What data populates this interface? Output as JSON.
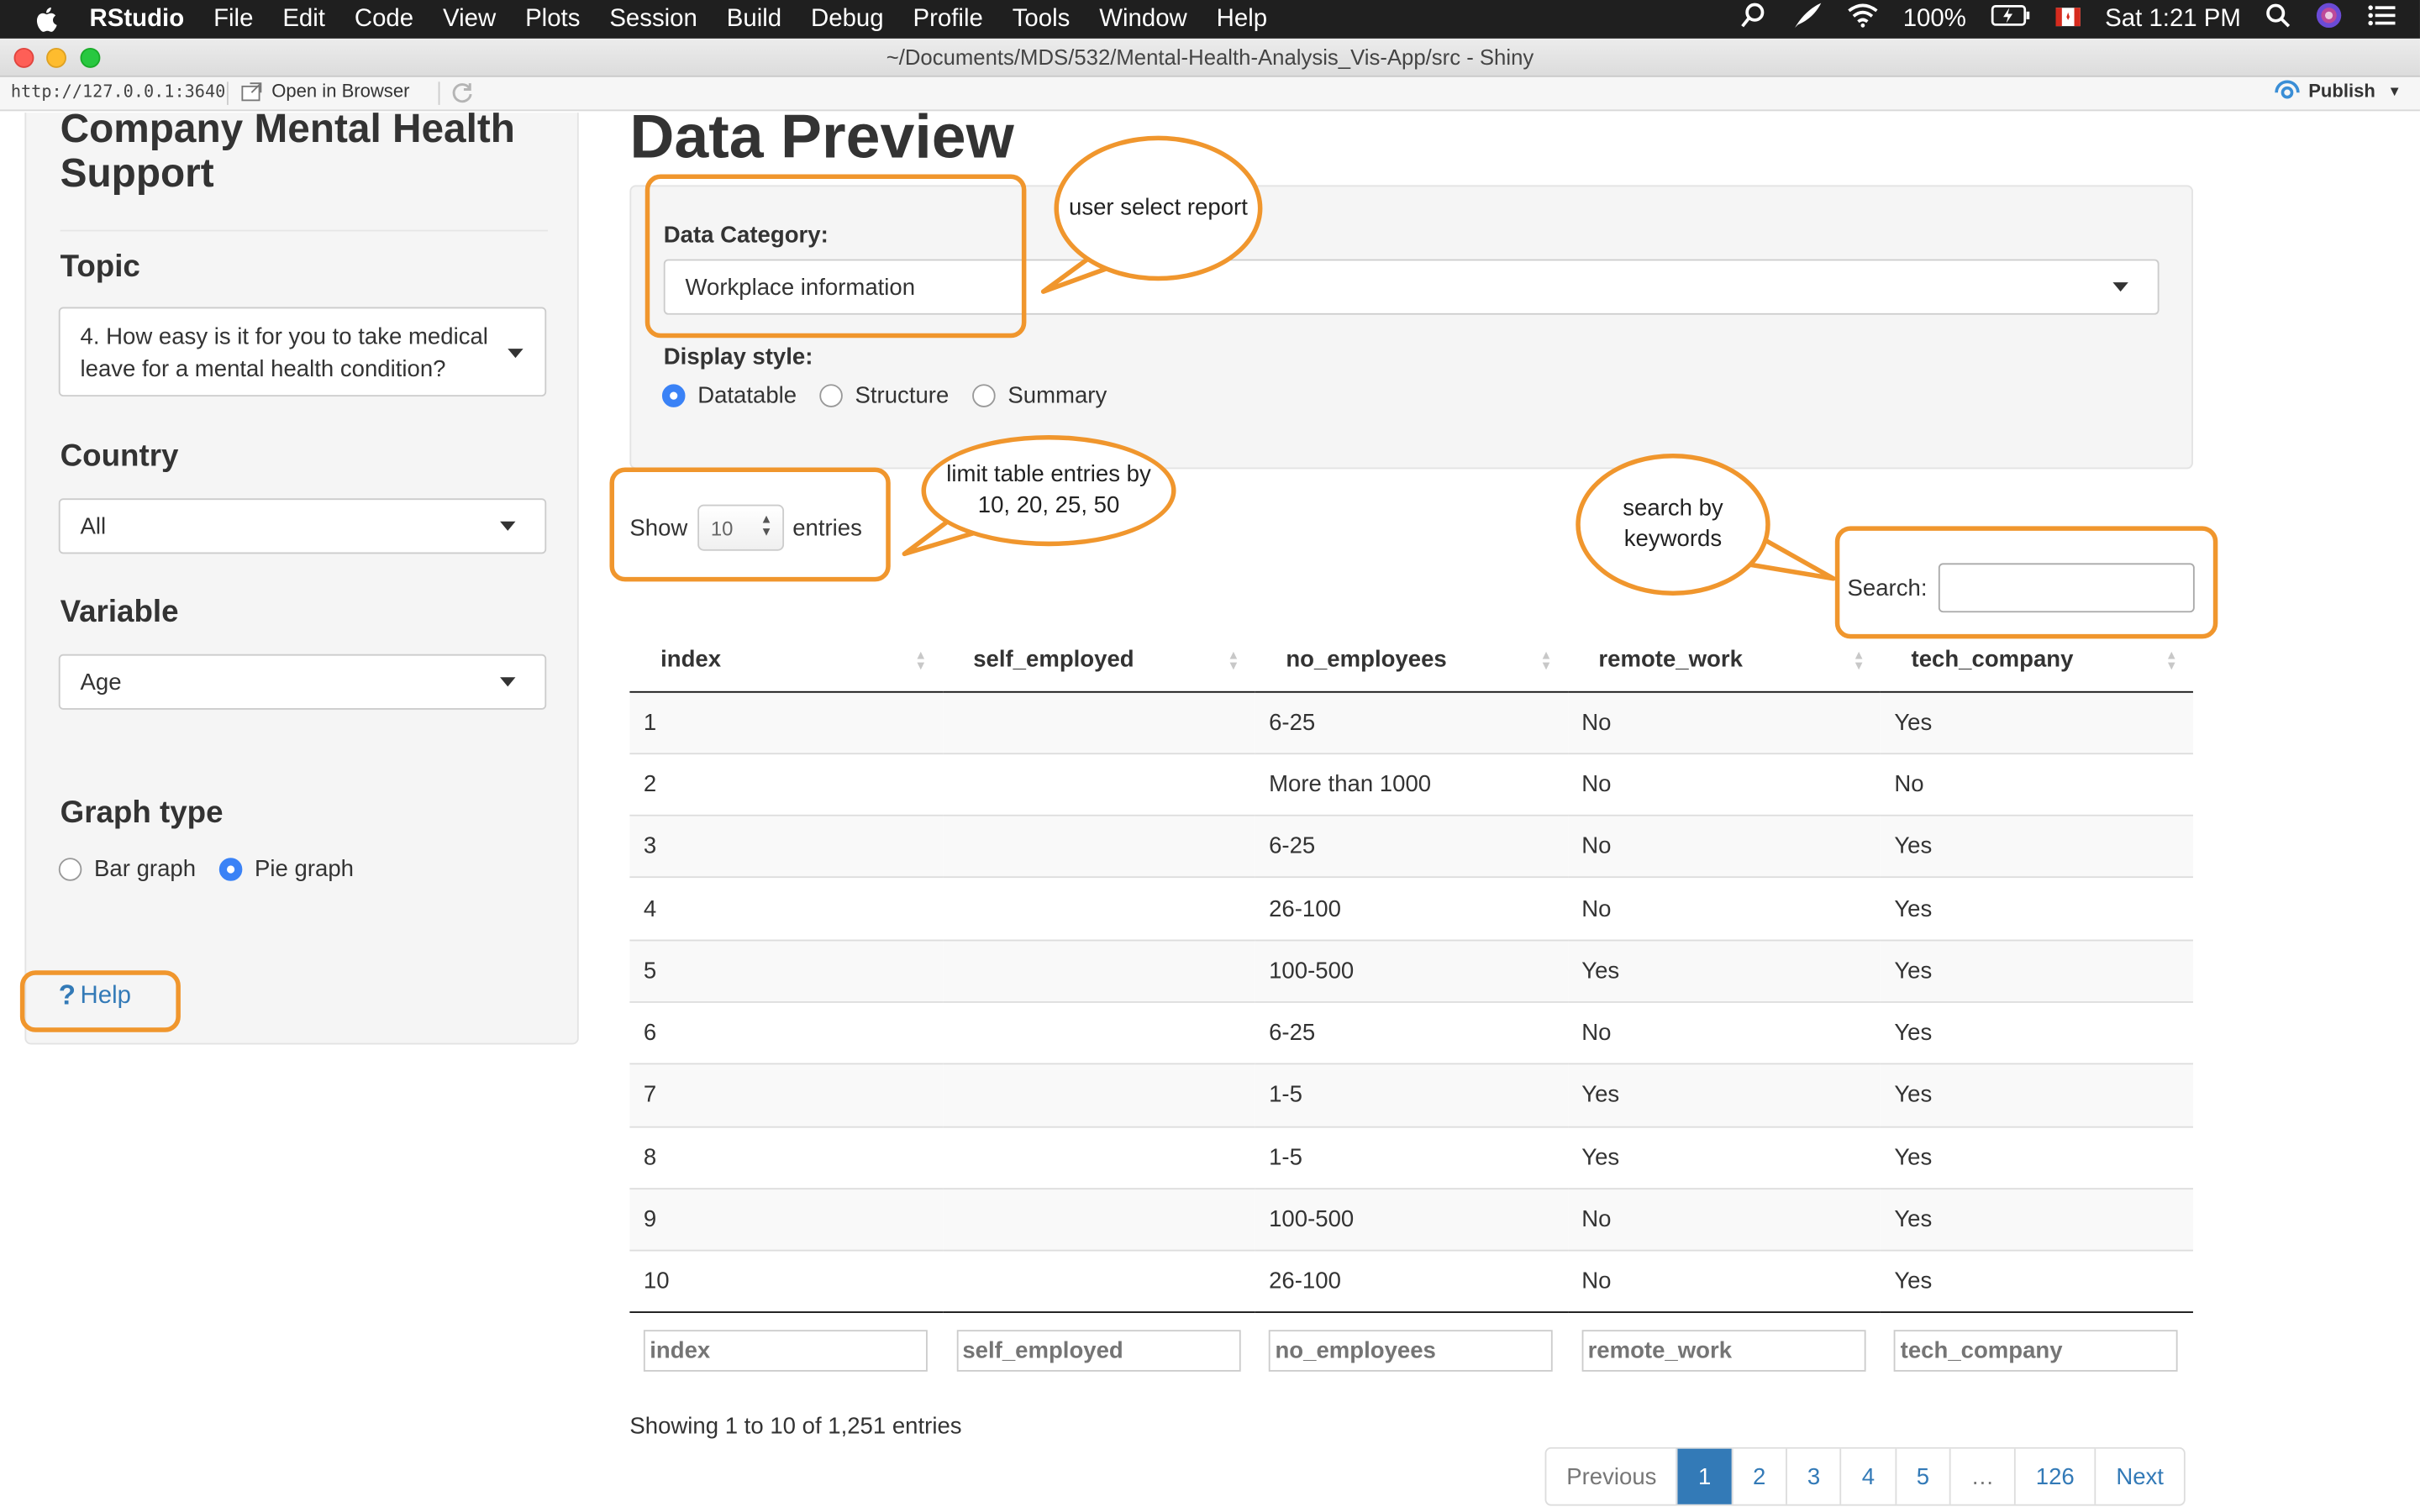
{
  "menubar": {
    "items": [
      "RStudio",
      "File",
      "Edit",
      "Code",
      "View",
      "Plots",
      "Session",
      "Build",
      "Debug",
      "Profile",
      "Tools",
      "Window",
      "Help"
    ],
    "battery": "100%",
    "clock": "Sat 1:21 PM"
  },
  "window": {
    "title": "~/Documents/MDS/532/Mental-Health-Analysis_Vis-App/src - Shiny"
  },
  "toolbar": {
    "url": "http://127.0.0.1:3640",
    "open_in_browser": "Open in Browser",
    "publish": "Publish"
  },
  "sidebar": {
    "app_title": "Company Mental Health Support",
    "topic_label": "Topic",
    "topic_value": "4. How easy is it for you to take medical leave for a mental health condition?",
    "country_label": "Country",
    "country_value": "All",
    "variable_label": "Variable",
    "variable_value": "Age",
    "graph_type_label": "Graph type",
    "graph_options": [
      "Bar graph",
      "Pie graph"
    ],
    "graph_selected": "Pie graph",
    "help": "Help"
  },
  "main": {
    "title": "Data Preview",
    "data_category_label": "Data Category:",
    "data_category_value": "Workplace information",
    "display_style_label": "Display style:",
    "display_options": [
      "Datatable",
      "Structure",
      "Summary"
    ],
    "display_selected": "Datatable"
  },
  "table": {
    "show_label": "Show",
    "entries_label": "entries",
    "length_value": "10",
    "search_label": "Search:",
    "columns": [
      "index",
      "self_employed",
      "no_employees",
      "remote_work",
      "tech_company"
    ],
    "rows": [
      [
        "1",
        "",
        "6-25",
        "No",
        "Yes"
      ],
      [
        "2",
        "",
        "More than 1000",
        "No",
        "No"
      ],
      [
        "3",
        "",
        "6-25",
        "No",
        "Yes"
      ],
      [
        "4",
        "",
        "26-100",
        "No",
        "Yes"
      ],
      [
        "5",
        "",
        "100-500",
        "Yes",
        "Yes"
      ],
      [
        "6",
        "",
        "6-25",
        "No",
        "Yes"
      ],
      [
        "7",
        "",
        "1-5",
        "Yes",
        "Yes"
      ],
      [
        "8",
        "",
        "1-5",
        "Yes",
        "Yes"
      ],
      [
        "9",
        "",
        "100-500",
        "No",
        "Yes"
      ],
      [
        "10",
        "",
        "26-100",
        "No",
        "Yes"
      ]
    ],
    "info": "Showing 1 to 10 of 1,251 entries",
    "pagination": [
      "Previous",
      "1",
      "2",
      "3",
      "4",
      "5",
      "…",
      "126",
      "Next"
    ],
    "current_page": "1"
  },
  "annotations": {
    "category_note": "user select report",
    "entries_note": "limit table entries by 10, 20, 25, 50",
    "search_note": "search by keywords"
  },
  "colors": {
    "annotation": "#f0962d",
    "link": "#337ab7",
    "radio_selected": "#3a82f6"
  }
}
